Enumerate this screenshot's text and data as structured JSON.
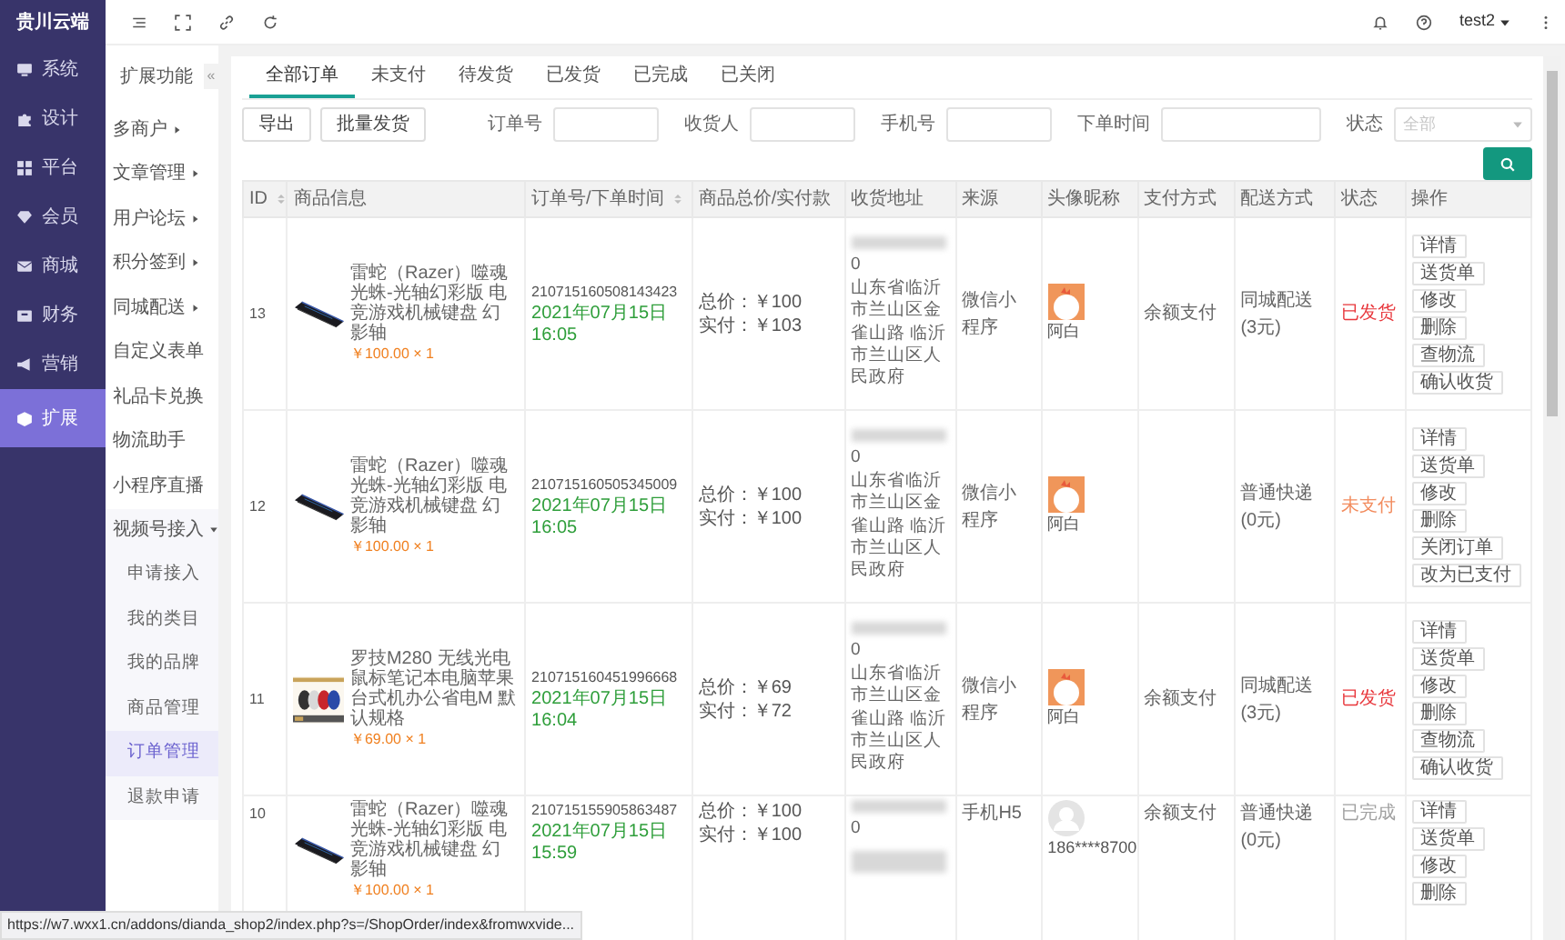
{
  "app": {
    "logo": "贵川云端"
  },
  "main_menu": [
    {
      "label": "系统",
      "selected": false
    },
    {
      "label": "设计",
      "selected": false
    },
    {
      "label": "平台",
      "selected": false
    },
    {
      "label": "会员",
      "selected": false
    },
    {
      "label": "商城",
      "selected": false
    },
    {
      "label": "财务",
      "selected": false
    },
    {
      "label": "营销",
      "selected": false
    },
    {
      "label": "扩展",
      "selected": true
    }
  ],
  "toolbar": {
    "user": "test2"
  },
  "sub_menu": {
    "title": "扩展功能",
    "collapse": "«",
    "items": [
      {
        "label": "多商户",
        "kind": "group",
        "expanded": false
      },
      {
        "label": "文章管理",
        "kind": "group",
        "expanded": false
      },
      {
        "label": "用户论坛",
        "kind": "group",
        "expanded": false
      },
      {
        "label": "积分签到",
        "kind": "group",
        "expanded": false
      },
      {
        "label": "同城配送",
        "kind": "group",
        "expanded": false
      },
      {
        "label": "自定义表单",
        "kind": "link"
      },
      {
        "label": "礼品卡兑换",
        "kind": "link"
      },
      {
        "label": "物流助手",
        "kind": "link"
      },
      {
        "label": "小程序直播",
        "kind": "link"
      },
      {
        "label": "视频号接入",
        "kind": "group",
        "expanded": true,
        "children": [
          {
            "label": "申请接入",
            "selected": false
          },
          {
            "label": "我的类目",
            "selected": false
          },
          {
            "label": "我的品牌",
            "selected": false
          },
          {
            "label": "商品管理",
            "selected": false
          },
          {
            "label": "订单管理",
            "selected": true
          },
          {
            "label": "退款申请",
            "selected": false
          }
        ]
      }
    ]
  },
  "tabs": [
    {
      "label": "全部订单",
      "selected": true
    },
    {
      "label": "未支付",
      "selected": false
    },
    {
      "label": "待发货",
      "selected": false
    },
    {
      "label": "已发货",
      "selected": false
    },
    {
      "label": "已完成",
      "selected": false
    },
    {
      "label": "已关闭",
      "selected": false
    }
  ],
  "filters": {
    "buttons": [
      "导出",
      "批量发货"
    ],
    "fields": [
      {
        "label": "订单号",
        "kind": "text"
      },
      {
        "label": "收货人",
        "kind": "text"
      },
      {
        "label": "手机号",
        "kind": "text"
      },
      {
        "label": "下单时间",
        "kind": "wide"
      }
    ],
    "status": {
      "label": "状态",
      "placeholder": "全部"
    }
  },
  "table": {
    "columns": [
      {
        "label": "ID",
        "sortable": true
      },
      {
        "label": "商品信息",
        "sortable": false
      },
      {
        "label": "订单号/下单时间",
        "sortable": true
      },
      {
        "label": "商品总价/实付款",
        "sortable": false
      },
      {
        "label": "收货地址",
        "sortable": false
      },
      {
        "label": "来源",
        "sortable": false
      },
      {
        "label": "头像昵称",
        "sortable": false
      },
      {
        "label": "支付方式",
        "sortable": false
      },
      {
        "label": "配送方式",
        "sortable": false
      },
      {
        "label": "状态",
        "sortable": false
      },
      {
        "label": "操作",
        "sortable": false
      }
    ],
    "rows": [
      {
        "id": "13",
        "product": {
          "title": "雷蛇（Razer）噬魂光蛛-光轴幻彩版 电竞游戏机械键盘 幻影轴",
          "price": "￥100.00 × 1"
        },
        "order_no": "210715160508143423",
        "time": "2021年07月15日 16:05",
        "total": "总价：￥100",
        "paid": "实付：￥103",
        "address": [
          "0",
          "山东省临沂市兰山区金雀山路 临沂市兰山区人民政府"
        ],
        "source": "微信小程序",
        "nickname": "阿白",
        "payment": "余额支付",
        "delivery": "同城配送(3元)",
        "status": {
          "label": "已发货",
          "color": "#e8373c"
        },
        "actions": [
          "详情",
          "送货单",
          "修改",
          "删除",
          "查物流",
          "确认收货"
        ]
      },
      {
        "id": "12",
        "product": {
          "title": "雷蛇（Razer）噬魂光蛛-光轴幻彩版 电竞游戏机械键盘 幻影轴",
          "price": "￥100.00 × 1"
        },
        "order_no": "210715160505345009",
        "time": "2021年07月15日 16:05",
        "total": "总价：￥100",
        "paid": "实付：￥100",
        "address": [
          "0",
          "山东省临沂市兰山区金雀山路 临沂市兰山区人民政府"
        ],
        "source": "微信小程序",
        "nickname": "阿白",
        "delivery": "普通快递(0元)",
        "status": {
          "label": "未支付",
          "color": "#f28c5e"
        },
        "actions": [
          "详情",
          "送货单",
          "修改",
          "删除",
          "关闭订单",
          "改为已支付"
        ]
      },
      {
        "id": "11",
        "product": {
          "title": "罗技M280 无线光电鼠标笔记本电脑苹果台式机办公省电M 默认规格",
          "price": "￥69.00 × 1"
        },
        "order_no": "210715160451996668",
        "time": "2021年07月15日 16:04",
        "total": "总价：￥69",
        "paid": "实付：￥72",
        "address": [
          "0",
          "山东省临沂市兰山区金雀山路 临沂市兰山区人民政府"
        ],
        "source": "微信小程序",
        "nickname": "阿白",
        "payment": "余额支付",
        "delivery": "同城配送(3元)",
        "status": {
          "label": "已发货",
          "color": "#e8373c"
        },
        "actions": [
          "详情",
          "送货单",
          "修改",
          "删除",
          "查物流",
          "确认收货"
        ]
      },
      {
        "id": "10",
        "product": {
          "title": "雷蛇（Razer）噬魂光蛛-光轴幻彩版 电竞游戏机械键盘 幻影轴",
          "price": "￥100.00 × 1"
        },
        "order_no": "210715155905863487",
        "time": "2021年07月15日 15:59",
        "total": "总价：￥100",
        "paid": "实付：￥100",
        "address": [
          "0"
        ],
        "source": "手机H5",
        "avatar": {
          "kind": "default"
        },
        "nickname": "186****8700",
        "payment": "余额支付",
        "delivery": "普通快递(0元)",
        "status": {
          "label": "已完成",
          "color": "#a0a0a0"
        },
        "actions": [
          "详情",
          "送货单",
          "修改",
          "删除"
        ]
      }
    ]
  },
  "status_bar": {
    "url": "https://w7.wxx1.cn/addons/dianda_shop2/index.php?s=/ShopOrder/index&fromwxvide..."
  }
}
